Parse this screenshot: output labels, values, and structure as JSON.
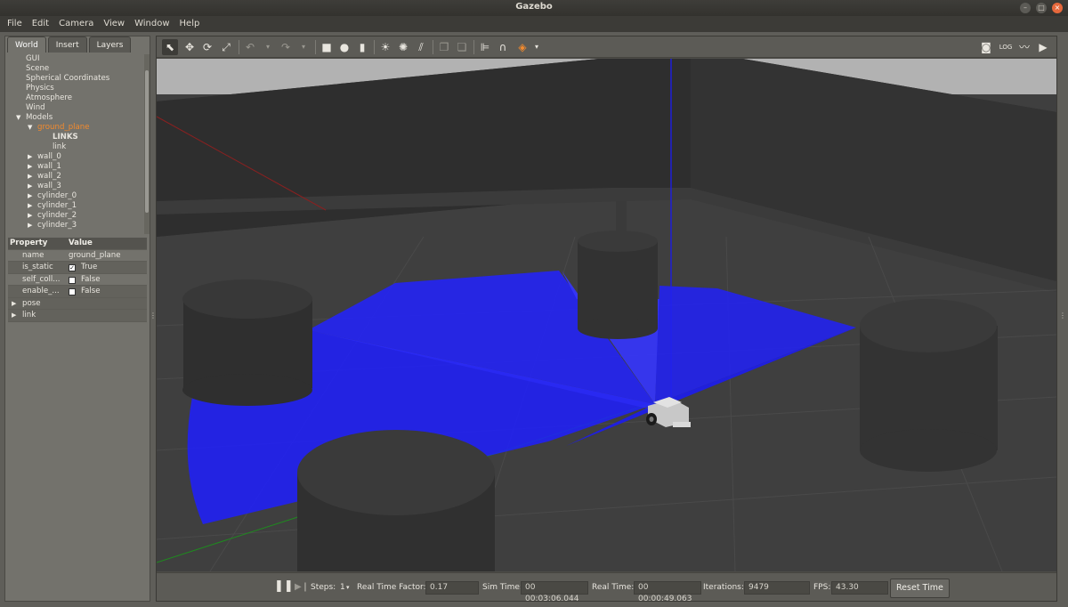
{
  "window": {
    "title": "Gazebo"
  },
  "menubar": [
    "File",
    "Edit",
    "Camera",
    "View",
    "Window",
    "Help"
  ],
  "tabs": [
    "World",
    "Insert",
    "Layers"
  ],
  "tree": [
    {
      "label": "GUI",
      "indent": 0,
      "arrow": ""
    },
    {
      "label": "Scene",
      "indent": 0,
      "arrow": ""
    },
    {
      "label": "Spherical Coordinates",
      "indent": 0,
      "arrow": ""
    },
    {
      "label": "Physics",
      "indent": 0,
      "arrow": ""
    },
    {
      "label": "Atmosphere",
      "indent": 0,
      "arrow": ""
    },
    {
      "label": "Wind",
      "indent": 0,
      "arrow": ""
    },
    {
      "label": "Models",
      "indent": 0,
      "arrow": "down"
    },
    {
      "label": "ground_plane",
      "indent": 1,
      "arrow": "down",
      "selected": true
    },
    {
      "label": "LINKS",
      "indent": 2,
      "arrow": "",
      "bold": true
    },
    {
      "label": "link",
      "indent": 2,
      "arrow": ""
    },
    {
      "label": "wall_0",
      "indent": 1,
      "arrow": "right"
    },
    {
      "label": "wall_1",
      "indent": 1,
      "arrow": "right"
    },
    {
      "label": "wall_2",
      "indent": 1,
      "arrow": "right"
    },
    {
      "label": "wall_3",
      "indent": 1,
      "arrow": "right"
    },
    {
      "label": "cylinder_0",
      "indent": 1,
      "arrow": "right"
    },
    {
      "label": "cylinder_1",
      "indent": 1,
      "arrow": "right"
    },
    {
      "label": "cylinder_2",
      "indent": 1,
      "arrow": "right"
    },
    {
      "label": "cylinder_3",
      "indent": 1,
      "arrow": "right"
    }
  ],
  "properties": {
    "header": {
      "property": "Property",
      "value": "Value"
    },
    "rows": [
      {
        "key": "name",
        "value": "ground_plane",
        "checkbox": false
      },
      {
        "key": "is_static",
        "value": "True",
        "checkbox": true,
        "checked": true
      },
      {
        "key": "self_coll...",
        "value": "False",
        "checkbox": true,
        "checked": false
      },
      {
        "key": "enable_...",
        "value": "False",
        "checkbox": true,
        "checked": false
      }
    ],
    "groups": [
      "pose",
      "link"
    ]
  },
  "toolbar": {
    "left_icons": [
      "select-icon",
      "translate-icon",
      "rotate-icon",
      "scale-icon",
      "undo-icon",
      "redo-icon",
      "box-icon",
      "sphere-icon",
      "cylinder-icon",
      "point-light-icon",
      "spot-light-icon",
      "directional-light-icon",
      "copy-icon",
      "paste-icon",
      "align-icon",
      "snap-icon",
      "view-angle-icon"
    ],
    "right_icons": [
      "screenshot-icon",
      "log-icon",
      "plot-icon",
      "video-record-icon"
    ]
  },
  "bottombar": {
    "steps_label": "Steps:",
    "steps_value": "1",
    "rtf_label": "Real Time Factor:",
    "rtf_value": "0.17",
    "simtime_label": "Sim Time:",
    "simtime_value": "00 00:03:06.044",
    "realtime_label": "Real Time:",
    "realtime_value": "00 00:00:49.063",
    "iterations_label": "Iterations:",
    "iterations_value": "9479",
    "fps_label": "FPS:",
    "fps_value": "43.30",
    "reset_label": "Reset Time"
  },
  "colors": {
    "accent_selected": "#f28a2e",
    "laser": "#1f1fff",
    "ground": "#3e3e3e",
    "sky": "#b3b3b3"
  }
}
